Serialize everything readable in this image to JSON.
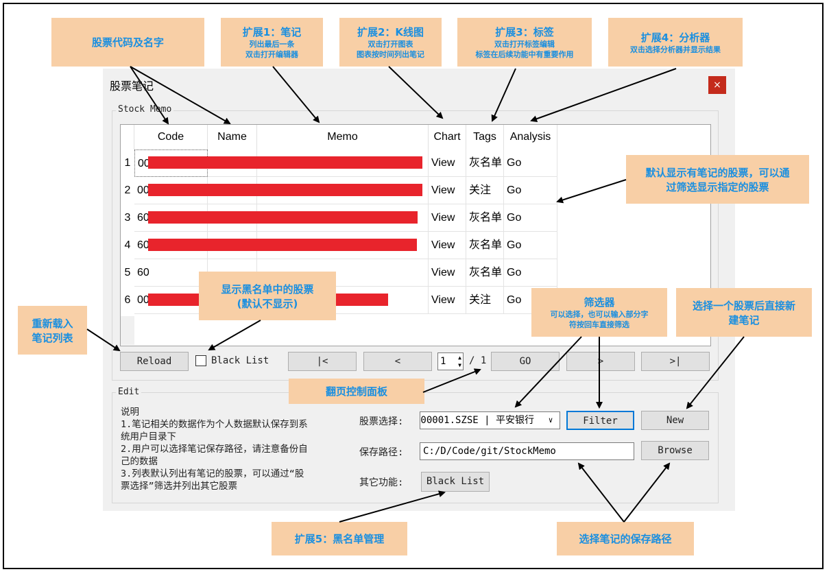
{
  "dialog": {
    "title": "股票笔记",
    "close": "×",
    "stock_group_label": "Stock Memo",
    "edit_group_label": "Edit"
  },
  "table": {
    "headers": [
      "Code",
      "Name",
      "Memo",
      "Chart",
      "Tags",
      "Analysis"
    ],
    "rows": [
      {
        "num": "1",
        "code": "00",
        "chart": "View",
        "tags": "灰名单",
        "analysis": "Go"
      },
      {
        "num": "2",
        "code": "00",
        "chart": "View",
        "tags": "关注",
        "analysis": "Go"
      },
      {
        "num": "3",
        "code": "60",
        "chart": "View",
        "tags": "灰名单",
        "analysis": "Go"
      },
      {
        "num": "4",
        "code": "60",
        "chart": "View",
        "tags": "灰名单",
        "analysis": "Go"
      },
      {
        "num": "5",
        "code": "60",
        "chart": "View",
        "tags": "灰名单",
        "analysis": "Go"
      },
      {
        "num": "6",
        "code": "00",
        "chart": "View",
        "tags": "关注",
        "analysis": "Go"
      }
    ]
  },
  "pager": {
    "reload": "Reload",
    "blacklist_check": "Black List",
    "first": "|<",
    "prev": "<",
    "page": "1",
    "total": "/ 1",
    "go": "GO",
    "next": ">",
    "last": ">|"
  },
  "edit": {
    "desc": [
      "说明",
      "1.笔记相关的数据作为个人数据默认保存到系",
      "统用户目录下",
      "2.用户可以选择笔记保存路径，请注意备份自",
      "己的数据",
      "3.列表默认列出有笔记的股票，可以通过“股",
      "票选择”筛选并列出其它股票"
    ],
    "stock_label": "股票选择:",
    "stock_value": "000001.SZSE | 平安银行",
    "filter": "Filter",
    "new": "New",
    "path_label": "保存路径:",
    "path_value": "C:/D/Code/git/StockMemo",
    "browse": "Browse",
    "other_label": "其它功能:",
    "blacklist_btn": "Black List"
  },
  "notes": {
    "code_name": "股票代码及名字",
    "ext1_title": "扩展1：笔记",
    "ext1_l1": "列出最后一条",
    "ext1_l2": "双击打开编辑器",
    "ext2_title": "扩展2：K线图",
    "ext2_l1": "双击打开图表",
    "ext2_l2": "图表按时间列出笔记",
    "ext3_title": "扩展3：标签",
    "ext3_l1": "双击打开标签编辑",
    "ext3_l2": "标签在后续功能中有重要作用",
    "ext4_title": "扩展4：分析器",
    "ext4_l1": "双击选择分析器并显示结果",
    "default_l1": "默认显示有笔记的股票，可以通",
    "default_l2": "过筛选显示指定的股票",
    "blacklist_l1": "显示黑名单中的股票",
    "blacklist_l2": "(默认不显示)",
    "reload_l1": "重新载入",
    "reload_l2": "笔记列表",
    "filter_title": "筛选器",
    "filter_l1": "可以选择，也可以输入部分字",
    "filter_l2": "符按回车直接筛选",
    "new_l1": "选择一个股票后直接新",
    "new_l2": "建笔记",
    "pager": "翻页控制面板",
    "ext5": "扩展5：黑名单管理",
    "path": "选择笔记的保存路径"
  },
  "colors": {
    "annotation_bg": "#f8cfa6",
    "annotation_text": "#1a8fe0",
    "redaction": "#e8242c",
    "close_btn": "#c42b1c"
  }
}
